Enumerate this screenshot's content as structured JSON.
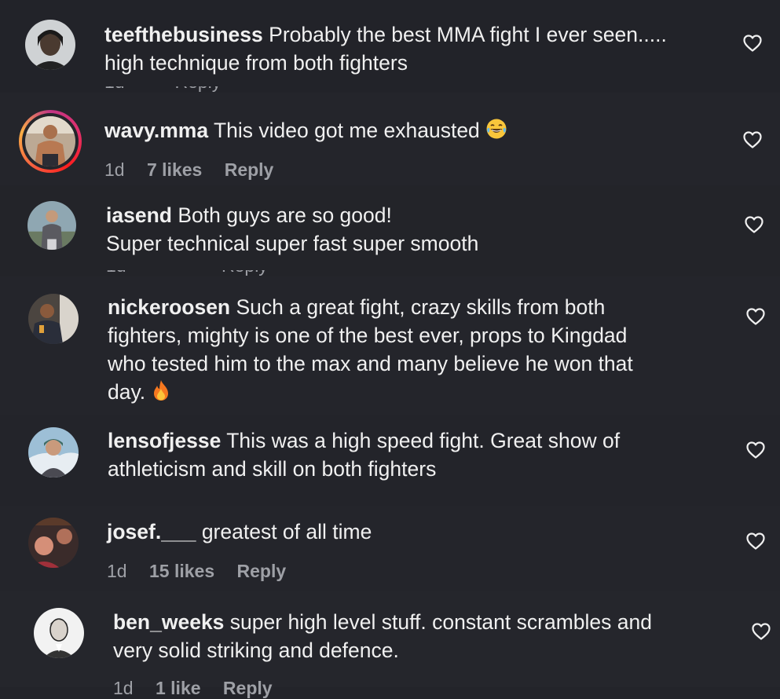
{
  "comments": [
    {
      "username": "teefthebusiness",
      "lines": [
        "Probably the best MMA fight I ever seen.....",
        "high technique from both fighters"
      ],
      "meta": null,
      "avatar": "avatar-teefthebusiness"
    },
    {
      "username": "wavy.mma",
      "lines": [
        "This video got me exhausted"
      ],
      "emoji": "laughing-tears-emoji",
      "meta": {
        "age": "1d",
        "likes": "7 likes",
        "reply": "Reply"
      },
      "story_ring": true,
      "avatar": "avatar-wavy-mma"
    },
    {
      "username": "iasend",
      "lines": [
        "Both guys are so good!",
        "Super technical super fast super smooth"
      ],
      "meta": null,
      "avatar": "avatar-iasend"
    },
    {
      "username": "nickeroosen",
      "lines": [
        "Such a great fight, crazy skills from both",
        "fighters, mighty is one of the best ever, props to Kingdad",
        "who tested him to the max and many believe he won that",
        "day."
      ],
      "emoji": "fire-emoji",
      "meta": null,
      "avatar": "avatar-nickeroosen"
    },
    {
      "username": "lensofjesse",
      "lines": [
        "This was a high speed fight. Great show of",
        "athleticism and skill on both fighters"
      ],
      "meta": null,
      "avatar": "avatar-lensofjesse"
    },
    {
      "username": "josef.___",
      "lines": [
        "greatest of all time"
      ],
      "meta": {
        "age": "1d",
        "likes": "15 likes",
        "reply": "Reply"
      },
      "avatar": "avatar-josef"
    },
    {
      "username": "ben_weeks",
      "lines": [
        "super high level stuff. constant scrambles and",
        "very solid striking and defence."
      ],
      "meta": {
        "age": "1d",
        "likes": "1 like",
        "reply": "Reply"
      },
      "avatar": "avatar-ben-weeks"
    }
  ],
  "icons": {
    "like": "heart-outline-icon"
  },
  "colors": {
    "background": "#23242a",
    "text": "#f0f0f0",
    "meta": "#9ea0a6",
    "ring_start": "#c13584",
    "ring_end": "#fcaf45"
  }
}
